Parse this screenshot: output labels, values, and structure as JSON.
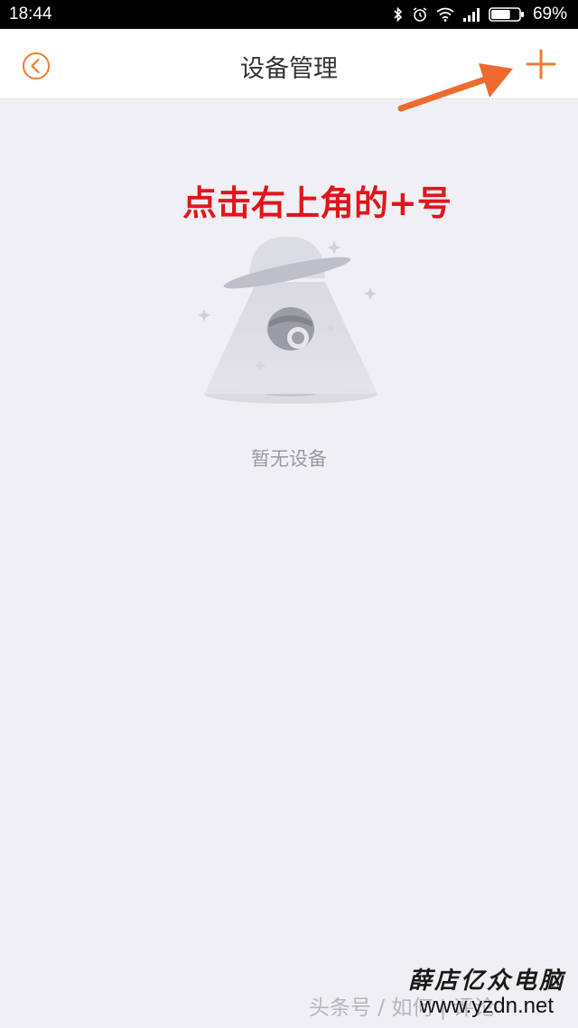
{
  "status_bar": {
    "time": "18:44",
    "battery": "69%",
    "battery_level": 0.69,
    "icons": [
      "bluetooth-icon",
      "alarm-icon",
      "wifi-icon",
      "signal-icon",
      "battery-icon"
    ]
  },
  "nav": {
    "title": "设备管理",
    "back_icon": "chevron-left-circle-icon",
    "add_icon": "plus-icon"
  },
  "annotation": {
    "text": "点击右上角的+号"
  },
  "empty_state": {
    "text": "暂无设备",
    "illustration": "ufo-camera-illustration"
  },
  "watermark": {
    "left_text": "头条号 / 如何 | 评论",
    "right_top": "薛店亿众电脑",
    "right_bottom": "www.yzdn.net"
  },
  "colors": {
    "accent": "#f07a33",
    "annotation_red": "#e3141b",
    "background": "#f0eff4",
    "status_bar": "#000000"
  }
}
